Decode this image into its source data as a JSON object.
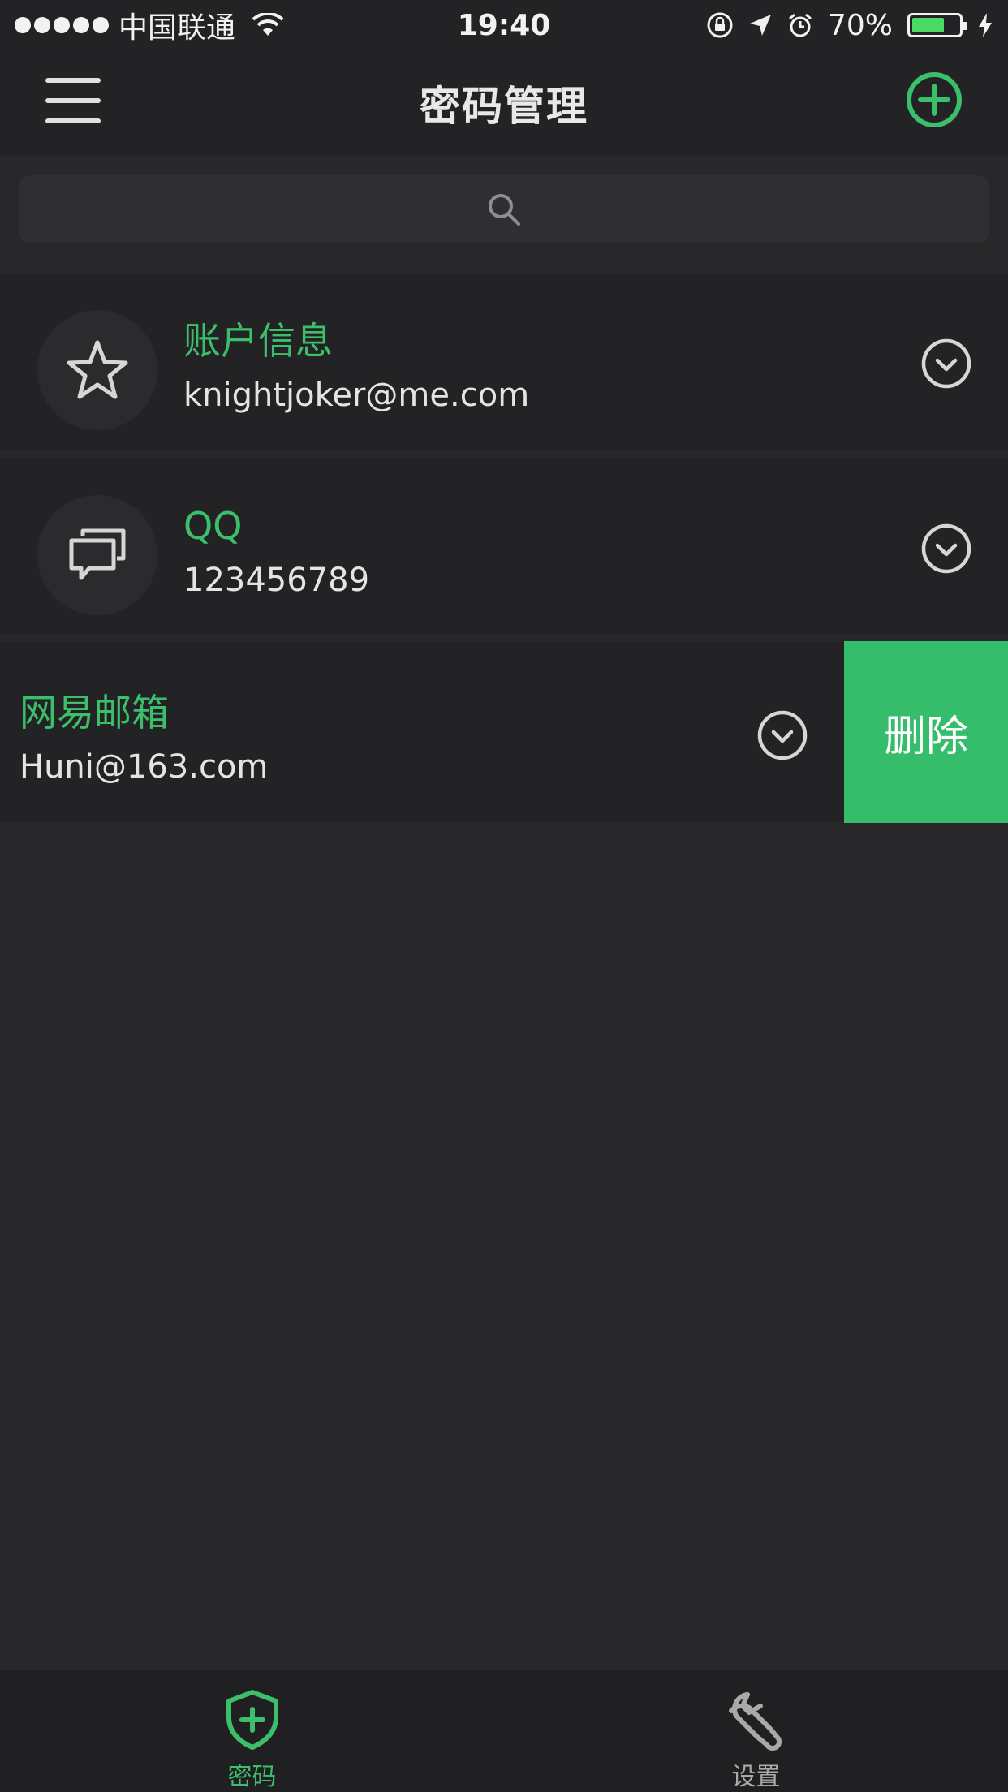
{
  "status_bar": {
    "carrier": "中国联通",
    "time": "19:40",
    "battery": "70%",
    "battery_level": 0.7
  },
  "nav": {
    "title": "密码管理"
  },
  "entries": [
    {
      "title": "账户信息",
      "subtitle": "knightjoker@me.com",
      "icon": "star-icon"
    },
    {
      "title": "QQ",
      "subtitle": "123456789",
      "icon": "chat-bubbles-icon"
    },
    {
      "title": "网易邮箱",
      "subtitle": "Huni@163.com",
      "action": "删除"
    }
  ],
  "tabs": [
    {
      "label": "密码",
      "icon": "shield-plus-icon",
      "active": true
    },
    {
      "label": "设置",
      "icon": "wrench-icon",
      "active": false
    }
  ],
  "colors": {
    "accent": "#3cbf6a",
    "delete": "#35bd6c",
    "background": "#28282a",
    "surface": "#232325"
  }
}
